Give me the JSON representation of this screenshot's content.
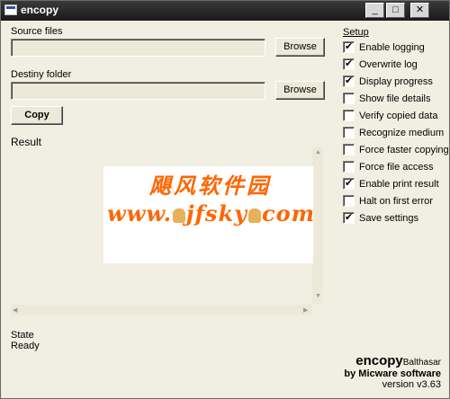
{
  "window": {
    "title": "encopy"
  },
  "source": {
    "label": "Source files",
    "value": "",
    "browse_label": "Browse"
  },
  "destiny": {
    "label": "Destiny folder",
    "value": "",
    "browse_label": "Browse"
  },
  "copy_label": "Copy",
  "result_label": "Result",
  "watermark": {
    "line1": "飓风软件园",
    "line2_a": "www.",
    "line2_b": "jfsky",
    "line2_c": "com"
  },
  "setup": {
    "label": "Setup",
    "options": [
      {
        "label": "Enable logging",
        "checked": true
      },
      {
        "label": "Overwrite log",
        "checked": true
      },
      {
        "label": "Display progress",
        "checked": true
      },
      {
        "label": "Show file details",
        "checked": false
      },
      {
        "label": "Verify copied data",
        "checked": false
      },
      {
        "label": "Recognize medium",
        "checked": false
      },
      {
        "label": "Force faster copying",
        "checked": false
      },
      {
        "label": "Force file access",
        "checked": false
      },
      {
        "label": "Enable print result",
        "checked": true
      },
      {
        "label": "Halt on first error",
        "checked": false
      },
      {
        "label": "Save settings",
        "checked": true
      }
    ]
  },
  "state": {
    "label": "State",
    "value": "Ready"
  },
  "branding": {
    "name": "encopy",
    "sub": "Balthasar",
    "by": "by Micware software",
    "version": "version v3.63"
  },
  "colors": {
    "titlebar": "#1a1a1a",
    "watermark": "#ff6600",
    "window_bg": "#f1efe2"
  }
}
